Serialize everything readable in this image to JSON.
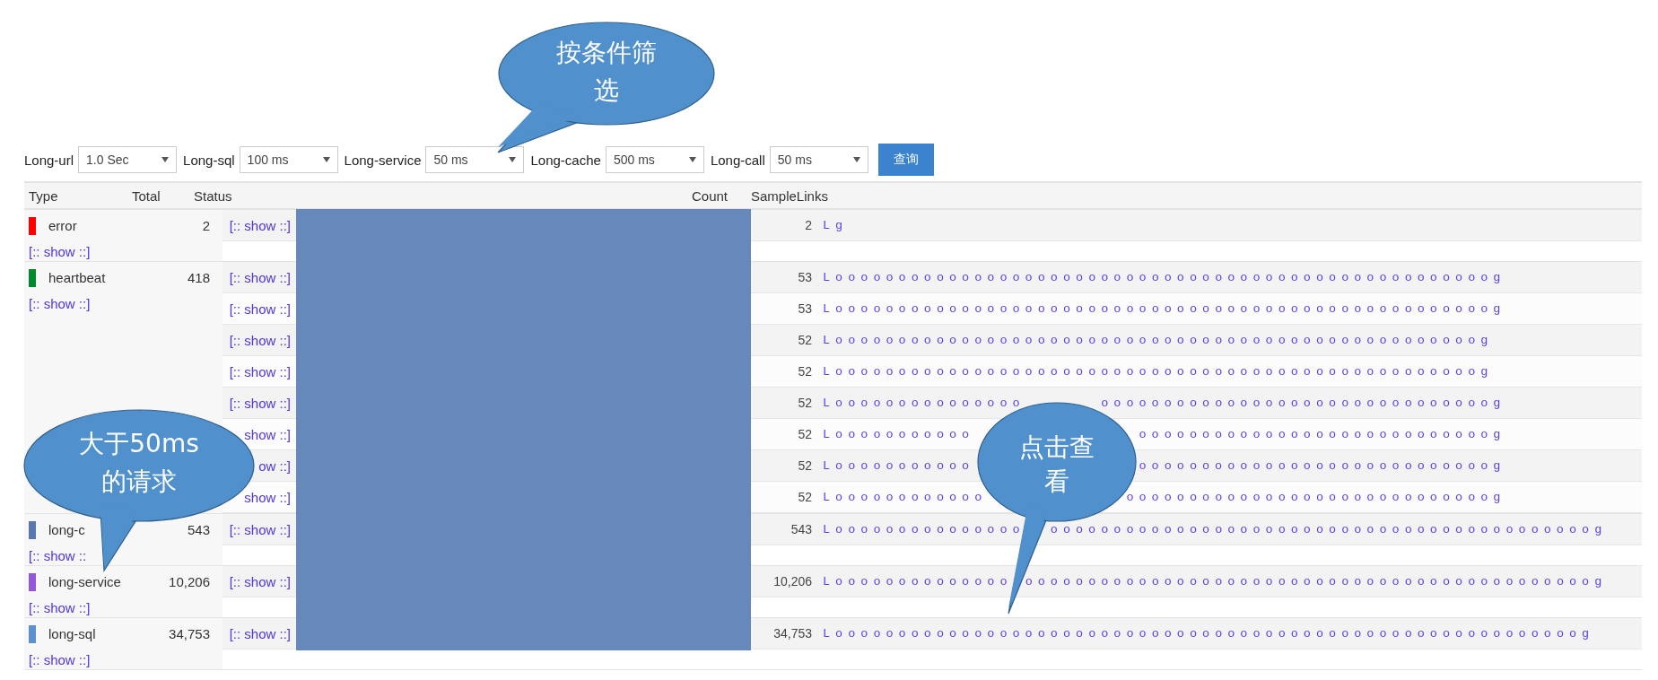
{
  "filters": [
    {
      "label": "Long-url",
      "value": "1.0 Sec"
    },
    {
      "label": "Long-sql",
      "value": "100 ms"
    },
    {
      "label": "Long-service",
      "value": "50 ms"
    },
    {
      "label": "Long-cache",
      "value": "500 ms"
    },
    {
      "label": "Long-call",
      "value": "50 ms"
    }
  ],
  "query_button": "查询",
  "table": {
    "columns": [
      "Type",
      "Total",
      "Status",
      "Count",
      "SampleLinks"
    ],
    "groups": [
      {
        "type": "error",
        "color": "#ff0000",
        "total": "2",
        "show_link": "[:: show ::]",
        "rows": [
          {
            "status": "[:: show ::]",
            "count": "2",
            "sample": [
              "Lg"
            ]
          }
        ]
      },
      {
        "type": "heartbeat",
        "color": "#008a2e",
        "total": "418",
        "show_link": "[:: show ::]",
        "rows": [
          {
            "status": "[:: show ::]",
            "count": "53",
            "sample": [
              "Loooooooooooooooooooooooooooooooooooooooooooooooooooog"
            ]
          },
          {
            "status": "[:: show ::]",
            "count": "53",
            "sample": [
              "Loooooooooooooooooooooooooooooooooooooooooooooooooooog"
            ]
          },
          {
            "status": "[:: show ::]",
            "count": "52",
            "sample": [
              "Looooooooooooooooooooooooooooooooooooooooooooooooooog"
            ]
          },
          {
            "status": "[:: show ::]",
            "count": "52",
            "sample": [
              "Looooooooooooooooooooooooooooooooooooooooooooooooooog"
            ]
          },
          {
            "status": "[:: show ::]",
            "count": "52",
            "sample": [
              "Looooooooooooooo",
              "ooooooooooooooooooooooooooooooog"
            ]
          },
          {
            "status": "show ::]",
            "count": "52",
            "sample": [
              "Looooooooooo",
              "oooooooooooooooooooooooooooog"
            ]
          },
          {
            "status": "ow ::]",
            "count": "52",
            "sample": [
              "Looooooooooo",
              "oooooooooooooooooooooooooooog"
            ]
          },
          {
            "status": "show ::]",
            "count": "52",
            "sample": [
              "Loooooooooooo",
              "ooooooooooooooooooooooooooooog"
            ]
          }
        ]
      },
      {
        "type": "long-c",
        "color": "#5a77b0",
        "total": "543",
        "show_link": "[:: show ::",
        "rows": [
          {
            "status": "[:: show ::]",
            "count": "543",
            "sample": [
              "Looooooooooooooo",
              "ooooooooooooooooooooooooooooooooooooooooooog"
            ]
          }
        ]
      },
      {
        "type": "long-service",
        "color": "#9457d8",
        "total": "10,206",
        "show_link": "[:: show ::]",
        "rows": [
          {
            "status": "[:: show ::]",
            "count": "10,206",
            "sample": [
              "Loooooooooooooo",
              "ooooooooooooooooooooooooooooooooooooooooooooog"
            ]
          }
        ]
      },
      {
        "type": "long-sql",
        "color": "#5b8fd0",
        "total": "34,753",
        "show_link": "[:: show ::]",
        "rows": [
          {
            "status": "[:: show ::]",
            "count": "34,753",
            "sample": [
              "Looooooooooooooooooooooooooooooooooooooooooooooooooooooooooog"
            ]
          }
        ]
      }
    ]
  },
  "callouts": [
    {
      "text": "按条件筛选"
    },
    {
      "text": "大于50ms的请求"
    },
    {
      "text": "点击查看"
    }
  ]
}
